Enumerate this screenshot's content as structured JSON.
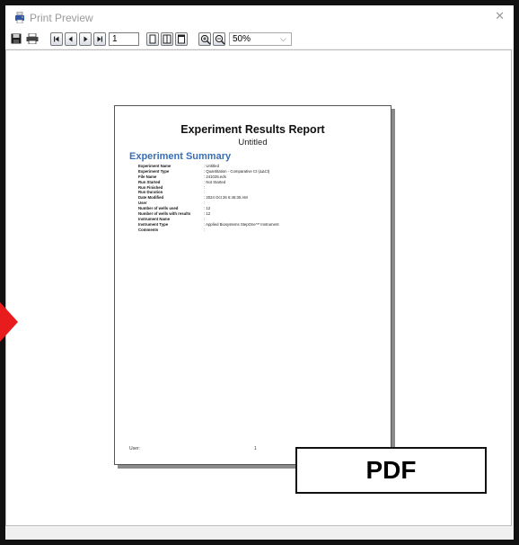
{
  "window": {
    "title": "Print Preview",
    "close_glyph": "✕"
  },
  "toolbar": {
    "page_number": "1",
    "zoom": "50%",
    "buttons": [
      {
        "name": "save-button",
        "icon": "floppy-icon"
      },
      {
        "name": "print-button",
        "icon": "printer-icon"
      },
      {
        "name": "first-page-button",
        "icon": "first-page-icon"
      },
      {
        "name": "prev-page-button",
        "icon": "prev-page-icon"
      },
      {
        "name": "next-page-button",
        "icon": "next-page-icon"
      },
      {
        "name": "last-page-button",
        "icon": "last-page-icon"
      },
      {
        "name": "single-page-view-button",
        "icon": "single-page-icon"
      },
      {
        "name": "two-page-view-button",
        "icon": "two-page-icon"
      },
      {
        "name": "page-setup-button",
        "icon": "page-setup-icon"
      },
      {
        "name": "zoom-in-button",
        "icon": "zoom-in-icon"
      },
      {
        "name": "zoom-out-button",
        "icon": "zoom-out-icon"
      }
    ]
  },
  "report": {
    "title": "Experiment Results Report",
    "subtitle": "Untitled",
    "section": "Experiment Summary",
    "rows": [
      {
        "label": "Experiment Name",
        "value": ": Untitled"
      },
      {
        "label": "Experiment Type",
        "value": ": Quantitation - Comparative Ct (ΔΔCt)"
      },
      {
        "label": "File Name",
        "value": ": 241025.eds"
      },
      {
        "label": "Run Started",
        "value": ": Not Started"
      },
      {
        "label": "Run Finished",
        "value": ":"
      },
      {
        "label": "Run Duration",
        "value": ":"
      },
      {
        "label": "Date Modified",
        "value": ": 2024 Oct 26 6:45:35 AM"
      },
      {
        "label": "User",
        "value": ":"
      },
      {
        "label": "Number of wells used",
        "value": ": 12"
      },
      {
        "label": "Number of wells with results",
        "value": ": 12"
      },
      {
        "label": "Instrument Name",
        "value": ":"
      },
      {
        "label": "Instrument Type",
        "value": ": Applied Biosystems StepOne™ Instrument"
      },
      {
        "label": "Comments",
        "value": ":"
      }
    ],
    "footer": {
      "user": "User:",
      "page": "1"
    }
  },
  "overlay": {
    "pdf_label": "PDF"
  },
  "colors": {
    "accent": "#3a6fb5",
    "arrow": "#e81c1c"
  }
}
